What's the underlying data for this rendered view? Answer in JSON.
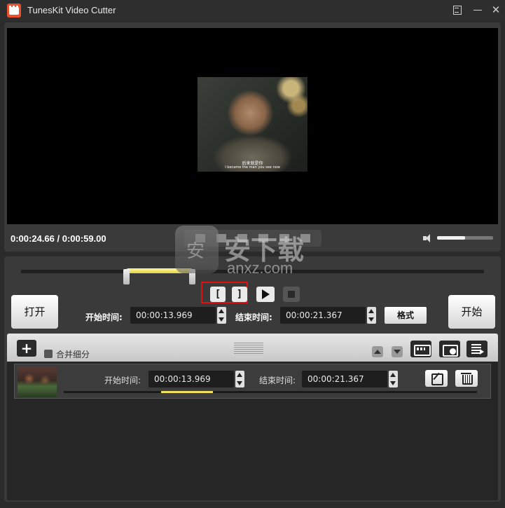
{
  "window": {
    "title": "TunesKit Video Cutter",
    "close_glyph": "✕"
  },
  "player": {
    "current_time": "0:00:24.66",
    "total_time": "0:00:59.00",
    "time_separator": " / ",
    "volume": 0.5,
    "subtitle_line1": "后来就是你",
    "subtitle_line2": "I became the man you see now"
  },
  "trim": {
    "mark_in_label": "[",
    "mark_out_label": "]",
    "open_button": "打开",
    "start_button": "开始",
    "start_time_label": "开始时间:",
    "start_time_value": "00:00:13.969",
    "end_time_label": "结束时间:",
    "end_time_value": "00:00:21.367",
    "format_button": "格式"
  },
  "segments_toolbar": {
    "add_glyph": "+",
    "merge_label": "合并细分"
  },
  "segments": [
    {
      "start_label": "开始时间:",
      "start_value": "00:00:13.969",
      "end_label": "结束时间:",
      "end_value": "00:00:21.367"
    }
  ],
  "watermark": {
    "text": "安下载",
    "sub": "anxz.com"
  }
}
